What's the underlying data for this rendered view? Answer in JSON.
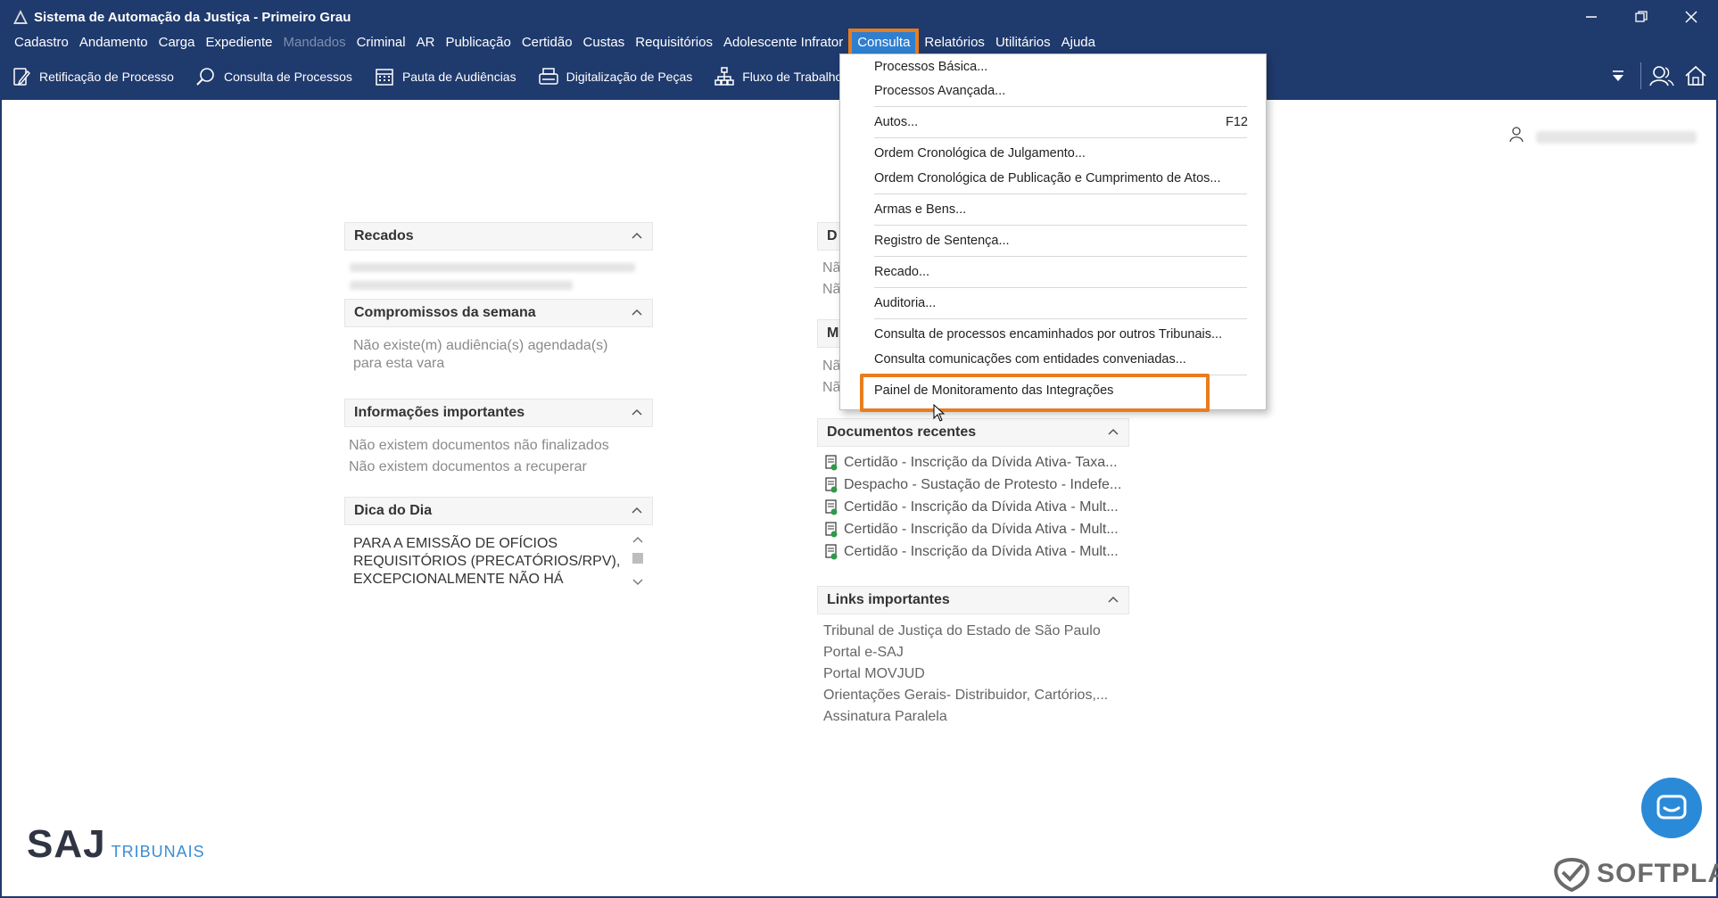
{
  "window": {
    "title": "Sistema de Automação da Justiça - Primeiro Grau"
  },
  "menubar": {
    "items": [
      {
        "label": "Cadastro"
      },
      {
        "label": "Andamento"
      },
      {
        "label": "Carga"
      },
      {
        "label": "Expediente"
      },
      {
        "label": "Mandados",
        "disabled": true
      },
      {
        "label": "Criminal"
      },
      {
        "label": "AR"
      },
      {
        "label": "Publicação"
      },
      {
        "label": "Certidão"
      },
      {
        "label": "Custas"
      },
      {
        "label": "Requisitórios"
      },
      {
        "label": "Adolescente Infrator"
      },
      {
        "label": "Consulta",
        "active": true
      },
      {
        "label": "Relatórios"
      },
      {
        "label": "Utilitários"
      },
      {
        "label": "Ajuda"
      }
    ]
  },
  "toolbar": {
    "retificacao": "Retificação de Processo",
    "consulta_processos": "Consulta de Processos",
    "pauta": "Pauta de Audiências",
    "digitalizacao": "Digitalização de Peças",
    "fluxo": "Fluxo de Trabalho"
  },
  "panels": {
    "recados": {
      "title": "Recados"
    },
    "compromissos": {
      "title": "Compromissos da semana",
      "line1": "Não existe(m) audiência(s) agendada(s)",
      "line2": "para esta vara"
    },
    "informacoes": {
      "title": "Informações importantes",
      "line1": "Não existem documentos não finalizados",
      "line2": "Não existem documentos a recuperar"
    },
    "dica": {
      "title": "Dica do Dia",
      "text": "PARA A EMISSÃO DE OFÍCIOS REQUISITÓRIOS (PRECATÓRIOS/RPV), EXCEPCIONALMENTE NÃO HÁ"
    },
    "partial_d": {
      "title": "D",
      "line1": "Nã",
      "line2": "Nã"
    },
    "partial_m": {
      "title": "M",
      "line1": "Nã",
      "line2": "Nã"
    },
    "documentos": {
      "title": "Documentos recentes",
      "items": [
        "Certidão - Inscrição da Dívida Ativa- Taxa...",
        "Despacho - Sustação de Protesto - Indefe...",
        "Certidão - Inscrição da Dívida Ativa - Mult...",
        "Certidão - Inscrição da Dívida Ativa - Mult...",
        "Certidão - Inscrição da Dívida Ativa - Mult..."
      ]
    },
    "links": {
      "title": "Links importantes",
      "items": [
        "Tribunal de Justiça do Estado de São Paulo",
        "Portal e-SAJ",
        "Portal MOVJUD",
        "Orientações Gerais- Distribuidor, Cartórios,...",
        "Assinatura Paralela"
      ]
    }
  },
  "dropdown": {
    "items": [
      "Processos Básica...",
      "Processos Avançada...",
      "Autos...",
      "Ordem Cronológica de Julgamento...",
      "Ordem Cronológica de Publicação e Cumprimento de Atos...",
      "Armas e Bens...",
      "Registro de Sentença...",
      "Recado...",
      "Auditoria...",
      "Consulta de processos encaminhados por outros Tribunais...",
      "Consulta comunicações com entidades conveniadas...",
      "Painel de Monitoramento das Integrações"
    ],
    "autos_shortcut": "F12"
  },
  "branding": {
    "saj": "SAJ",
    "saj_sub": "TRIBUNAIS",
    "softplan": "SOFTPLAN"
  },
  "colors": {
    "header_bg": "#1f3a6d",
    "highlight": "#e87d1e",
    "accent_blue": "#2a8ad8"
  }
}
